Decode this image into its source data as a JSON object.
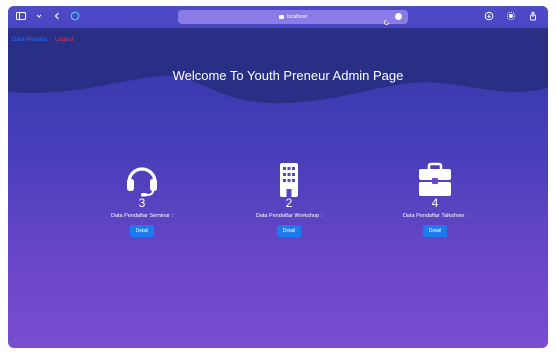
{
  "browser": {
    "address": "localhost"
  },
  "nav": {
    "home_label": "Data Peserta",
    "logout_label": "Logout"
  },
  "header": {
    "title": "Welcome To Youth Preneur Admin Page"
  },
  "cards": [
    {
      "icon": "headset-icon",
      "count": "3",
      "label": "Data Pendaftar Seminar :",
      "button": "Detail"
    },
    {
      "icon": "building-icon",
      "count": "2",
      "label": "Data Pendaftar Workshop :",
      "button": "Detail"
    },
    {
      "icon": "briefcase-icon",
      "count": "4",
      "label": "Data Pendaftar Talkshow :",
      "button": "Detail"
    }
  ],
  "colors": {
    "background_top": "#2e36a6",
    "background_bottom": "#7a4dd0",
    "wave": "#2a2f86",
    "button": "#1b7cf0",
    "nav_home": "#2a6cff",
    "nav_logout": "#e0354c"
  }
}
